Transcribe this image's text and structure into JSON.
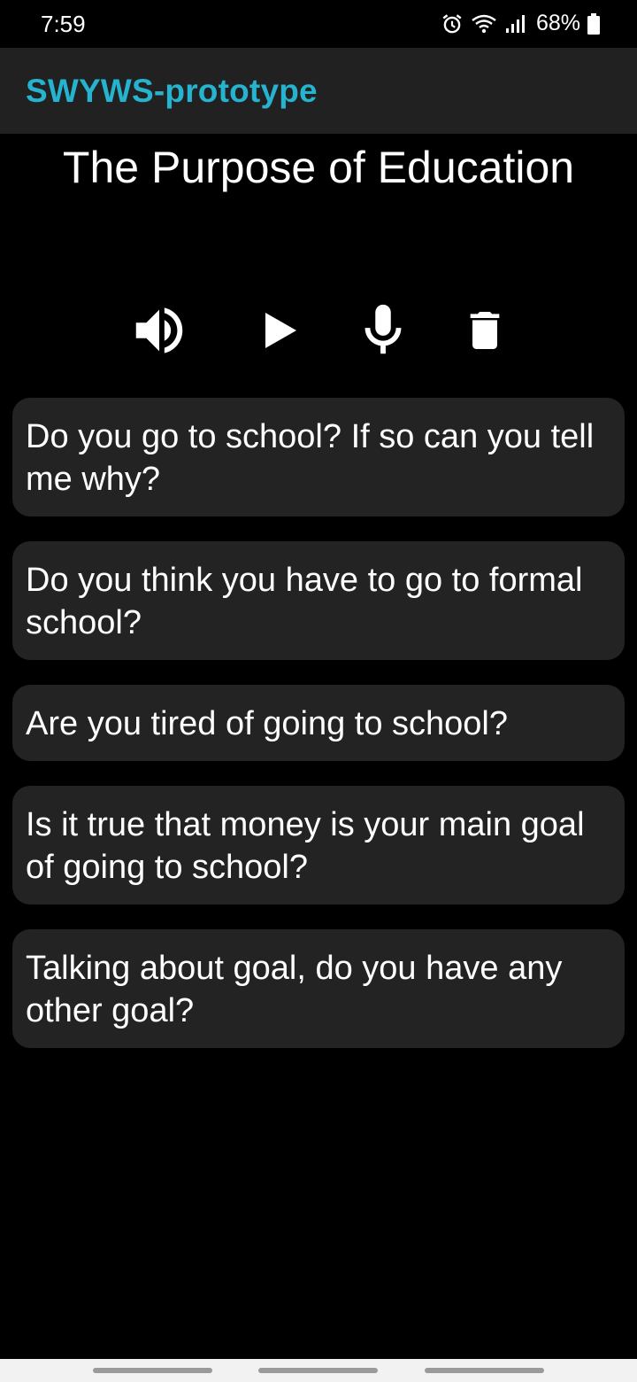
{
  "status_bar": {
    "time": "7:59",
    "battery_percent": "68%",
    "icons": [
      "alarm-icon",
      "wifi-icon",
      "signal-icon",
      "battery-icon"
    ]
  },
  "app_bar": {
    "title": "SWYWS-prototype",
    "title_color": "#26b3cf"
  },
  "page": {
    "title": "The Purpose of Education"
  },
  "controls": [
    "volume-icon",
    "play-icon",
    "microphone-icon",
    "trash-icon"
  ],
  "questions": [
    "Do you go to school? If so can you tell me why?",
    "Do you think you have to go to formal school?",
    "Are you tired of going to school?",
    "Is it true that money is your main goal of going to school?",
    "Talking about goal, do you have any other goal?"
  ]
}
